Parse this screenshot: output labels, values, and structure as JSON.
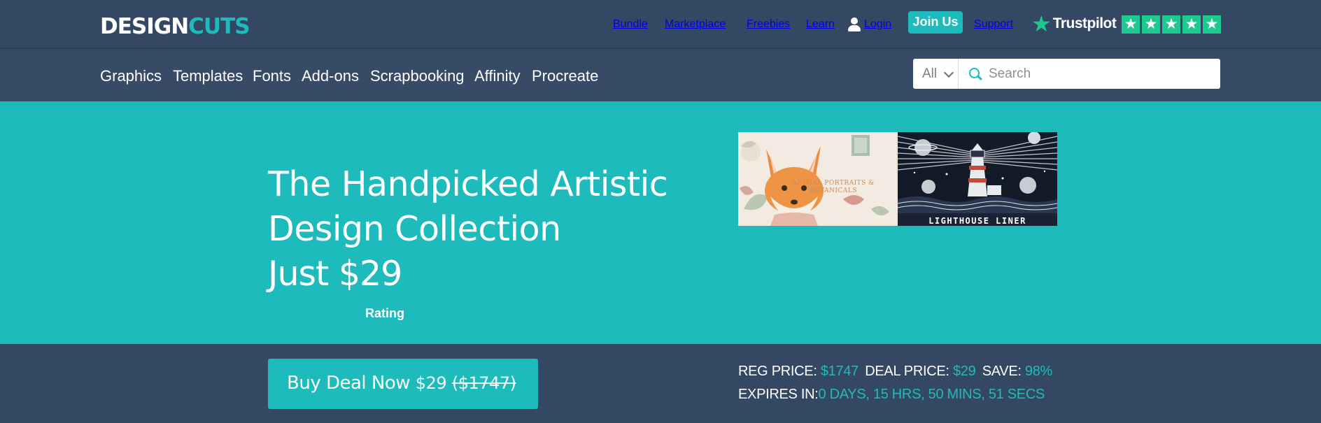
{
  "header": {
    "logo_part1": "DESIGN",
    "logo_part2": "CUTS",
    "nav": [
      "Bundle",
      "Marketplace",
      "Freebies",
      "Learn",
      "Login"
    ],
    "join_label": "Join Us",
    "support_label": "Support",
    "trustpilot_label": "Trustpilot",
    "trustpilot_stars": 5,
    "trustpilot_star_glyph": "★"
  },
  "categories": [
    "Graphics",
    "Templates",
    "Fonts",
    "Add-ons",
    "Scrapbooking",
    "Affinity",
    "Procreate"
  ],
  "search": {
    "filter_value": "All",
    "placeholder": "Search"
  },
  "hero": {
    "title_line1": "The Handpicked Artistic",
    "title_line2": "Design Collection",
    "price": "Just $29",
    "rating_label": "Rating",
    "products": [
      {
        "caption": "ANIMAL PORTRAITS & BOTANICALS"
      },
      {
        "caption": "LIGHTHOUSE LINER"
      }
    ]
  },
  "deal": {
    "buy_label": "Buy Deal Now",
    "buy_price": "$29",
    "buy_original": "($1747)",
    "reg_price_label": "REG PRICE:",
    "reg_price": "$1747",
    "deal_price_label": "DEAL PRICE:",
    "deal_price": "$29",
    "save_label": "SAVE:",
    "save_value": "98%",
    "expires_label": "EXPIRES IN:",
    "expires_value": "0 DAYS, 15 HRS, 50 MINS, 51 SECS"
  },
  "colors": {
    "navy": "#344863",
    "teal": "#1dbbbc",
    "trustpilot_green": "#1ec98f"
  }
}
